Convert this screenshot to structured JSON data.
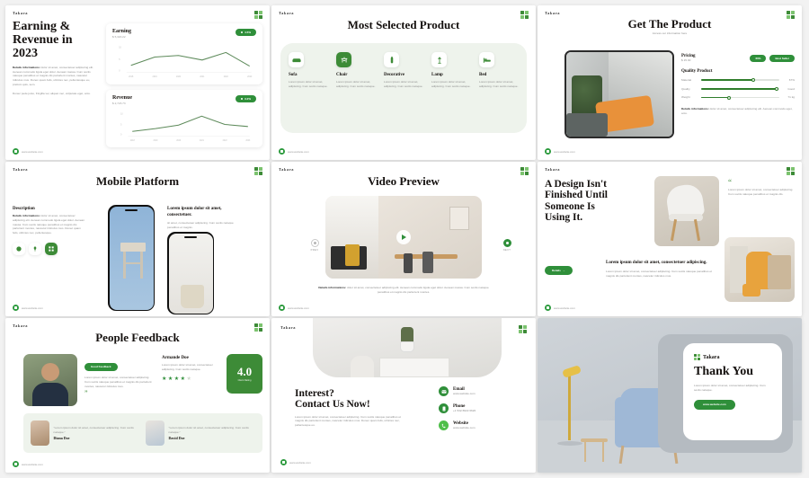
{
  "brand": "Takara",
  "website": "www.website.com",
  "colors": {
    "primary": "#3d8b37",
    "accent": "#2f8f3a",
    "panel": "#eef3ec",
    "dark": "#15110f"
  },
  "common": {
    "details_label": "Details informations:",
    "lorem_short": "Lorem ipsum dolor sit amet, adipiscing. Cum sociis natoque.",
    "lorem_med": "Lorem ipsum dolor sit amet, consectetuer adipiscing elit. Aenean commodo ligula eget dolor. Aenean massa. Cum sociis natoque penatibus et magnis dis parturient montes, nascetur ridiculus mus.",
    "lorem_long": "dolor sit amet, consectetuer adipiscing elit. Aenean commodo ligula eget dolor. Aenean massa. Cum sociis natoque penatibus et magnis dis parturient montes, nascetur ridiculus mus. Donec quam felis, ultricies nec, pellentesque eu, pretium quis, sem."
  },
  "slides": [
    {
      "id": "earning-revenue",
      "title": "Earning &\nRevenue in\n2023",
      "body": "dolor sit amet, consectetuer adipiscing elit. Aenean commodo ligula eget dolor. Aenean massa. Cum sociis natoque penatibus et magnis dis parturient montes, nascetur ridiculus mus. Donec quam felis, ultricies nec, pellentesque eu, pretium quis, sem.",
      "body2": "Donec pede justo, fringilla vel, aliquet nec, vulputate eget, arcu.",
      "charts": [
        {
          "name": "Earning",
          "value": "$ 5,320.22",
          "badge": "4.5%"
        },
        {
          "name": "Revenue",
          "value": "$ 2,723.73",
          "badge": "3.2%"
        }
      ]
    },
    {
      "id": "most-selected-product",
      "title": "Most Selected Product",
      "products": [
        {
          "name": "Sofa",
          "icon": "sofa-icon",
          "active": false,
          "desc": "Lorem ipsum dolor sit amet, adipiscing. Cum sociis natoque."
        },
        {
          "name": "Chair",
          "icon": "chair-icon",
          "active": true,
          "desc": "Lorem ipsum dolor sit amet, adipiscing. Cum sociis natoque."
        },
        {
          "name": "Decorative",
          "icon": "decorative-icon",
          "active": false,
          "desc": "Lorem ipsum dolor sit amet, adipiscing. Cum sociis natoque."
        },
        {
          "name": "Lamp",
          "icon": "lamp-icon",
          "active": false,
          "desc": "Lorem ipsum dolor sit amet, adipiscing. Cum sociis natoque."
        },
        {
          "name": "Bed",
          "icon": "bed-icon",
          "active": false,
          "desc": "Lorem ipsum dolor sit amet, adipiscing. Cum sociis natoque."
        }
      ]
    },
    {
      "id": "get-the-product",
      "title": "Get The Product",
      "subtitle": "Access our information here",
      "pricing_label": "Pricing",
      "price": "$ 15.30",
      "tag_discount": "60%",
      "tag_best": "Best Seller",
      "quality_label": "Quality Product",
      "specs": [
        {
          "name": "Material",
          "value": "67%",
          "pct": 67
        },
        {
          "name": "Quality",
          "value": "Good",
          "pct": 97
        },
        {
          "name": "Weight",
          "value": "71 kg",
          "pct": 36
        }
      ],
      "details": "dolor sit amet, consectetuer adipiscing elit. Aenean commodo eget, arcu."
    },
    {
      "id": "mobile-platform",
      "title": "Mobile Platform",
      "desc_title": "Description",
      "desc": "dolor sit amet, consectetuer adipiscing elit. Aenean commodo ligula eget dolor. Aenean massa. Cum sociis natoque penatibus et magnis dis parturient montes, nascetur ridiculus mus. Donec quam felis, ultricies nec, pellentesque.",
      "right_title": "Lorem ipsum dolor sit amet, consectetuer.",
      "right_body": "sit amet, consectetuer adipiscing. Cum sociis natoque penatibus et magnis.",
      "badges": [
        "android-icon",
        "apple-icon",
        "store-icon"
      ]
    },
    {
      "id": "video-preview",
      "title": "Video Preview",
      "prev": "PREV",
      "next": "NEXT",
      "caption": "dolor sit amet, consectetuer adipiscing elit. Aenean commodo ligula eget dolor. Aenean massa. Cum sociis natoque penatibus et magnis dis parturient montes."
    },
    {
      "id": "design-quote",
      "title": "A Design Isn't\nFinished Until\nSomeone Is\nUsing It.",
      "quote": "Lorem ipsum dolor sit amet, consectetuer adipiscing. Cum sociis natoque penatibus et magnis dis.",
      "button": "Details",
      "sub_title": "Lorem ipsum dolor sit amet, consectetuer adipiscing.",
      "sub_body": "Lorem ipsum dolor sit amet, consectetuer adipiscing. Cum sociis natoque penatibus et magnis dis parturient montes, nascetur ridiculus mus."
    },
    {
      "id": "people-feedback",
      "title": "People Feedback",
      "badge": "Good Feedback",
      "review": "Lorem ipsum dolor sit amet, consectetuer adipiscing. Cum sociis natoque penatibus et magnis dis parturient montes, nascetur ridiculus mus.",
      "reviewer": "Armande Doe",
      "reviewer_body": "Lorem ipsum dolor sit amet, consectetuer adipiscing. Cum sociis natoque.",
      "stars_filled": 4,
      "stars_total": 5,
      "score": "4.0",
      "score_label": "Client Rating",
      "testimonials": [
        {
          "text": "\"Lorem ipsum dolor sit amet, consectetuer adipiscing. Cum sociis natoque.\"",
          "name": "Diana Doe"
        },
        {
          "text": "\"Lorem ipsum dolor sit amet, consectetuer adipiscing. Cum sociis natoque.\"",
          "name": "David Doe"
        }
      ]
    },
    {
      "id": "contact-us",
      "title": "Interest?\nContact Us Now!",
      "body": "Lorem ipsum dolor sit amet, consectetuer adipiscing. Cum sociis natoque penatibus et magnis dis parturient montes, nascetur ridiculus mus. Donec quam felis, ultricies nec, pellentesque eu.",
      "contacts": [
        {
          "label": "Email",
          "value": "www.website.com",
          "icon": "mail-icon"
        },
        {
          "label": "Phone",
          "value": "+1 532-5622 6620",
          "icon": "phone-icon"
        },
        {
          "label": "Website",
          "value": "www.website.com",
          "icon": "call-icon"
        }
      ]
    },
    {
      "id": "thank-you",
      "brand": "Takara",
      "title": "Thank You",
      "body": "Lorem ipsum dolor sit amet, consectetuer adipiscing. Cum sociis natoque.",
      "button": "www.website.com"
    }
  ],
  "chart_data": [
    {
      "type": "line",
      "title": "Earning",
      "value": "$ 5,320.22",
      "x": [
        "2018",
        "2019",
        "2020",
        "2021",
        "2022",
        "2023"
      ],
      "values": [
        18,
        40,
        44,
        32,
        52,
        16
      ],
      "ylim": [
        0,
        70
      ],
      "ytick_labels": [
        "10",
        "5",
        "0"
      ],
      "xlabel": "",
      "ylabel": "",
      "grid": false,
      "legend": "none",
      "color": "#5d8a5a"
    },
    {
      "type": "line",
      "title": "Revenue",
      "value": "$ 2,723.73",
      "x": [
        "2018",
        "2019",
        "2020",
        "2021",
        "2022",
        "2023"
      ],
      "values": [
        14,
        22,
        32,
        58,
        34,
        28
      ],
      "ylim": [
        0,
        70
      ],
      "ytick_labels": [
        "10",
        "5",
        "0"
      ],
      "xlabel": "",
      "ylabel": "",
      "grid": false,
      "legend": "none",
      "color": "#5d8a5a"
    }
  ]
}
